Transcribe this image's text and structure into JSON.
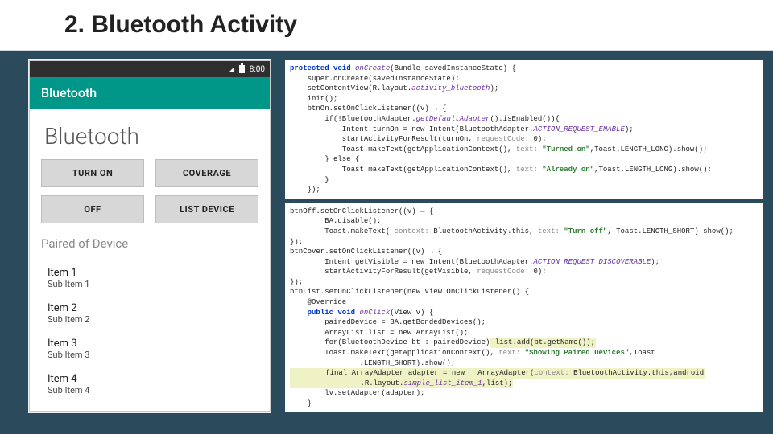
{
  "slide": {
    "title": "2. Bluetooth Activity"
  },
  "phone": {
    "status_time": "8:00",
    "appbar_title": "Bluetooth",
    "page_title": "Bluetooth",
    "buttons": [
      "TURN ON",
      "COVERAGE",
      "OFF",
      "LIST DEVICE"
    ],
    "paired_header": "Paired of Device",
    "list": [
      {
        "title": "Item 1",
        "sub": "Sub Item 1"
      },
      {
        "title": "Item 2",
        "sub": "Sub Item 2"
      },
      {
        "title": "Item 3",
        "sub": "Sub Item 3"
      },
      {
        "title": "Item 4",
        "sub": "Sub Item 4"
      }
    ]
  },
  "code_top": {
    "l0": "protected void ",
    "l0b": "onCreate",
    "l0c": "(Bundle savedInstanceState) {",
    "l1": "    super.onCreate(savedInstanceState);",
    "l2": "    setContentView(R.layout.",
    "l2b": "activity_bluetooth",
    "l2c": ");",
    "l3": "    init();",
    "l4": "",
    "l5": "    btnOn.setOnClickListener((v) → {",
    "l6": "        if(!BluetoothAdapter.",
    "l6b": "getDefaultAdapter",
    "l6c": "().isEnabled()){",
    "l7": "            Intent turnOn = new Intent(BluetoothAdapter.",
    "l7b": "ACTION_REQUEST_ENABLE",
    "l7c": ");",
    "l8": "            startActivityForResult(turnOn, ",
    "l8b": "requestCode:",
    "l8c": " 0);",
    "l9": "            Toast.makeText(getApplicationContext(), ",
    "l9b": "text:",
    "l9c": " \"Turned on\"",
    "l9d": ",Toast.LENGTH_LONG).show();",
    "l10": "        } else {",
    "l11": "            Toast.makeText(getApplicationContext(), ",
    "l11b": "text:",
    "l11c": " \"Already on\"",
    "l11d": ",Toast.LENGTH_LONG).show();",
    "l12": "        }",
    "l13": "    });"
  },
  "code_bottom": {
    "b0": "btnOff.setOnClickListener((v) → {",
    "b1": "        BA.disable();",
    "b2": "        Toast.makeText( ",
    "b2b": "context:",
    "b2c": " BluetoothActivity.this, ",
    "b2d": "text:",
    "b2e": " \"Turn off\"",
    "b2f": ", Toast.LENGTH_SHORT).show();",
    "b3": "});",
    "b4": "btnCover.setOnClickListener((v) → {",
    "b5": "        Intent getVisible = new Intent(BluetoothAdapter.",
    "b5b": "ACTION_REQUEST_DISCOVERABLE",
    "b5c": ");",
    "b6": "        startActivityForResult(getVisible, ",
    "b6b": "requestCode:",
    "b6c": " 0);",
    "b7": "});",
    "b8": "btnList.setOnClickListener(new View.OnClickListener() {",
    "b9": "    @Override",
    "b10": "    public void ",
    "b10b": "onClick",
    "b10c": "(View v) {",
    "b11": "        pairedDevice = BA.getBondedDevices();",
    "b12": "        ArrayList list = new ArrayList();",
    "b13a": "        for(BluetoothDevice bt : pairedDevice)",
    "b13b": " list.add(bt.getName());",
    "b14": "        Toast.makeText(getApplicationContext(), ",
    "b14b": "text:",
    "b14c": " \"Showing Paired Devices\"",
    "b14d": ",Toast",
    "b15": "                .LENGTH_SHORT).show();",
    "b16a": "        final ArrayAdapter adapter = new   ArrayAdapter(",
    "b16b": "context:",
    "b16c": " BluetoothActivity.this,android",
    "b17a": "                .R.layout.",
    "b17b": "simple_list_item_1",
    "b17c": ",list);",
    "b18": "        lv.setAdapter(adapter);",
    "b19": "    }"
  }
}
